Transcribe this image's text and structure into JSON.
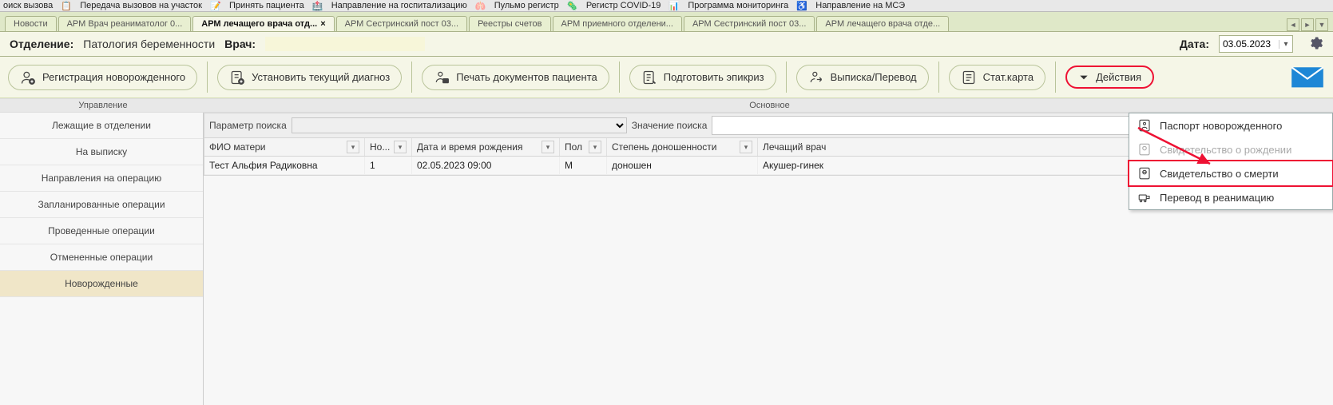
{
  "topmenu": {
    "items": [
      "оиск вызова",
      "Передача вызовов на участок",
      "Принять пациента",
      "Направление на госпитализацию",
      "Пульмо регистр",
      "Регистр COVID-19",
      "Программа мониторинга",
      "Направление на МСЭ"
    ]
  },
  "tabs": {
    "items": [
      {
        "label": "Новости",
        "active": false
      },
      {
        "label": "АРМ Врач реаниматолог 0...",
        "active": false
      },
      {
        "label": "АРМ лечащего врача отд...",
        "active": true
      },
      {
        "label": "АРМ Сестринский пост 03...",
        "active": false
      },
      {
        "label": "Реестры счетов",
        "active": false
      },
      {
        "label": "АРМ приемного отделени...",
        "active": false
      },
      {
        "label": "АРМ Сестринский пост 03...",
        "active": false
      },
      {
        "label": "АРМ лечащего врача отде...",
        "active": false
      }
    ]
  },
  "info": {
    "dep_label": "Отделение:",
    "dep_value": "Патология беременности",
    "doc_label": "Врач:",
    "doc_value": "",
    "date_label": "Дата:",
    "date_value": "03.05.2023"
  },
  "toolbar": {
    "b1": "Регистрация новорожденного",
    "b2": "Установить текущий диагноз",
    "b3": "Печать документов пациента",
    "b4": "Подготовить эпикриз",
    "b5": "Выписка/Перевод",
    "b6": "Стат.карта",
    "b7": "Действия"
  },
  "groups": {
    "g1": "Управление",
    "g2": "Основное"
  },
  "sidebar": {
    "items": [
      "Лежащие в отделении",
      "На выписку",
      "Направления на операцию",
      "Запланированные операции",
      "Проведенные операции",
      "Отмененные операции",
      "Новорожденные"
    ],
    "selected": 6
  },
  "search": {
    "param_label": "Параметр поиска",
    "param_value": "",
    "value_label": "Значение поиска",
    "value": ""
  },
  "columns": [
    "ФИО матери",
    "Но...",
    "Дата и время рождения",
    "Пол",
    "Степень доношенности",
    "Лечащий врач"
  ],
  "rows": [
    {
      "c1": "Тест Альфия Радиковна",
      "c2": "1",
      "c3": "02.05.2023 09:00",
      "c4": "М",
      "c5": "доношен",
      "c6": "                                     Акушер-гинек"
    }
  ],
  "menu": {
    "items": [
      {
        "label": "Паспорт новорожденного",
        "disabled": false,
        "highlight": false
      },
      {
        "label": "Свидетельство о рождении",
        "disabled": true,
        "highlight": false
      },
      {
        "label": "Свидетельство о смерти",
        "disabled": false,
        "highlight": true
      },
      {
        "label": "Перевод в реанимацию",
        "disabled": false,
        "highlight": false
      }
    ]
  }
}
